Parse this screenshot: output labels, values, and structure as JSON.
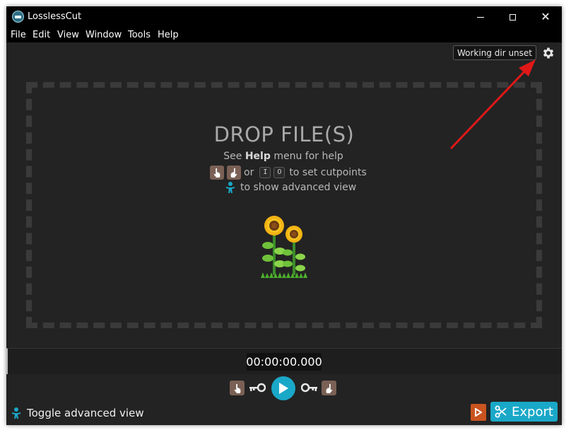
{
  "window": {
    "title": "LosslessCut",
    "controls": {
      "minimize": "minimize",
      "maximize": "maximize",
      "close": "✕"
    }
  },
  "menu": {
    "items": [
      "File",
      "Edit",
      "View",
      "Window",
      "Tools",
      "Help"
    ]
  },
  "toolbar": {
    "working_dir_label": "Working dir unset",
    "settings_icon": "gear-icon"
  },
  "dropzone": {
    "title": "DROP FILE(S)",
    "help_prefix": "See ",
    "help_bold": "Help",
    "help_suffix": " menu for help",
    "or_text": "or",
    "key_in": "I",
    "key_out": "O",
    "cutpoints_text": "to set cutpoints",
    "advanced_text": "to show advanced view"
  },
  "timeline": {
    "timecode": "00:00:00.000"
  },
  "bottom": {
    "toggle_advanced_label": "Toggle advanced view",
    "export_label": "Export"
  },
  "colors": {
    "accent": "#1aa8c8",
    "background": "#232323",
    "hand_button": "#7a6055",
    "record_button": "#c9541f",
    "annotation_arrow": "#e01818"
  }
}
